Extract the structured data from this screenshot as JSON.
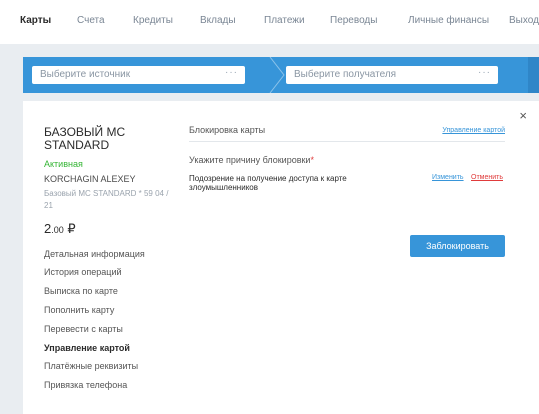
{
  "nav": {
    "items": [
      {
        "label": "Карты",
        "active": true
      },
      {
        "label": "Счета",
        "active": false
      },
      {
        "label": "Кредиты",
        "active": false
      },
      {
        "label": "Вклады",
        "active": false
      },
      {
        "label": "Платежи",
        "active": false
      },
      {
        "label": "Переводы",
        "active": false
      },
      {
        "label": "Личные финансы",
        "active": false
      },
      {
        "label": "Выход",
        "active": false
      }
    ]
  },
  "transfer": {
    "source_placeholder": "Выберите источник",
    "recipient_placeholder": "Выберите получателя",
    "dots": "···"
  },
  "card": {
    "title": "БАЗОВЫЙ MC STANDARD",
    "status": "Активная",
    "holder": "KORCHAGIN ALEXEY",
    "product": "Базовый MC STANDARD * 59 04 / 21",
    "balance_int": "2",
    "balance_dec": ".00",
    "currency": "₽"
  },
  "menu": {
    "items": [
      {
        "label": "Детальная информация",
        "active": false
      },
      {
        "label": "История операций",
        "active": false
      },
      {
        "label": "Выписка по карте",
        "active": false
      },
      {
        "label": "Пополнить карту",
        "active": false
      },
      {
        "label": "Перевести с карты",
        "active": false
      },
      {
        "label": "Управление картой",
        "active": true
      },
      {
        "label": "Платёжные реквизиты",
        "active": false
      },
      {
        "label": "Привязка телефона",
        "active": false
      }
    ]
  },
  "block": {
    "title": "Блокировка карты",
    "manage_link": "Управление картой",
    "reason_label": "Укажите причину блокировки",
    "required_mark": "*",
    "reason_value": "Подозрение на получение доступа к карте злоумышленников",
    "change_link": "Изменить",
    "cancel_link": "Отменить",
    "submit_label": "Заблокировать"
  },
  "close_symbol": "×",
  "colors": {
    "accent": "#3795d9",
    "active_status": "#35b535",
    "cancel": "#e03b3b",
    "background": "#e9edf1"
  }
}
